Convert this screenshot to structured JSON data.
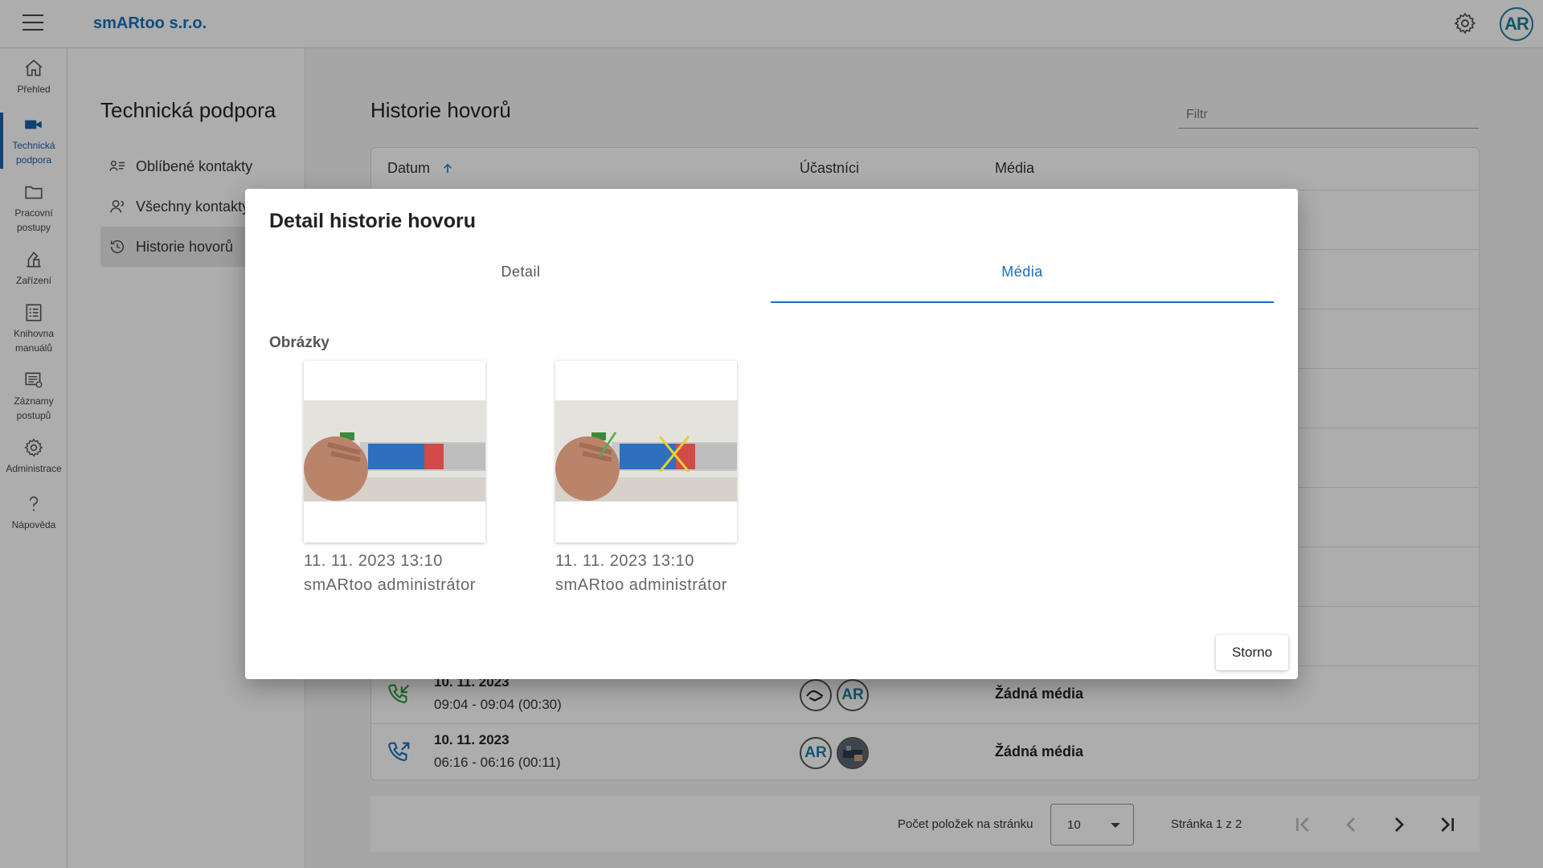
{
  "app": {
    "brand": "smARtoo s.r.o.",
    "avatar_initials": "AR"
  },
  "rail": {
    "items": [
      {
        "label_1": "Přehled",
        "label_2": ""
      },
      {
        "label_1": "Technická",
        "label_2": "podpora"
      },
      {
        "label_1": "Pracovní",
        "label_2": "postupy"
      },
      {
        "label_1": "Zařízení",
        "label_2": ""
      },
      {
        "label_1": "Knihovna",
        "label_2": "manuálů"
      },
      {
        "label_1": "Záznamy",
        "label_2": "postupů"
      },
      {
        "label_1": "Administrace",
        "label_2": ""
      },
      {
        "label_1": "Nápověda",
        "label_2": ""
      }
    ]
  },
  "subnav": {
    "title": "Technická podpora",
    "items": [
      {
        "label": "Oblíbené kontakty"
      },
      {
        "label": "Všechny kontakty"
      },
      {
        "label": "Historie hovorů"
      }
    ]
  },
  "main": {
    "title": "Historie hovorů",
    "filter_placeholder": "Filtr",
    "columns": {
      "date": "Datum",
      "participants": "Účastníci",
      "media": "Média"
    },
    "rows": [
      {
        "date": "10. 11. 2023",
        "time": "09:04 - 09:04 (00:30)",
        "media": "Žádná média",
        "avatar": "AR"
      },
      {
        "date": "10. 11. 2023",
        "time": "06:16 - 06:16 (00:11)",
        "media": "Žádná média",
        "avatar": "AR"
      }
    ]
  },
  "pager": {
    "per_page_label": "Počet položek na stránku",
    "per_page_value": "10",
    "page_info": "Stránka 1 z 2"
  },
  "dialog": {
    "title": "Detail historie hovoru",
    "tabs": {
      "detail": "Detail",
      "media": "Média"
    },
    "section_label": "Obrázky",
    "images": [
      {
        "date": "11. 11. 2023 13:10",
        "author": "smARtoo administrátor"
      },
      {
        "date": "11. 11. 2023 13:10",
        "author": "smARtoo administrátor"
      }
    ],
    "cancel_label": "Storno"
  },
  "colors": {
    "accent": "#1a6fb5",
    "call_in": "#2e9e3a",
    "call_out": "#1a6fb5"
  }
}
